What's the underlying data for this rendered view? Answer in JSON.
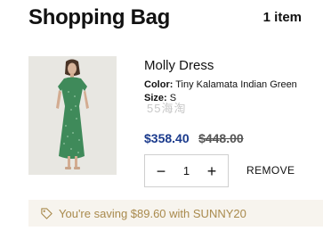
{
  "header": {
    "title": "Shopping Bag",
    "item_count": "1 item"
  },
  "cart_item": {
    "image_icon": "product-photo",
    "name": "Molly Dress",
    "color_label": "Color:",
    "color_value": "Tiny Kalamata Indian Green",
    "size_label": "Size:",
    "size_value": "S",
    "sale_price": "$358.40",
    "original_price": "$448.00",
    "quantity": "1",
    "decrement_symbol": "−",
    "increment_symbol": "+",
    "remove_label": "REMOVE"
  },
  "watermark": "55海淘",
  "savings": {
    "icon": "tag-icon",
    "text": "You're saving $89.60 with SUNNY20"
  },
  "colors": {
    "sale_price": "#1a3a8c",
    "savings_text": "#a98a4d",
    "savings_bg": "#f7f4ee"
  }
}
